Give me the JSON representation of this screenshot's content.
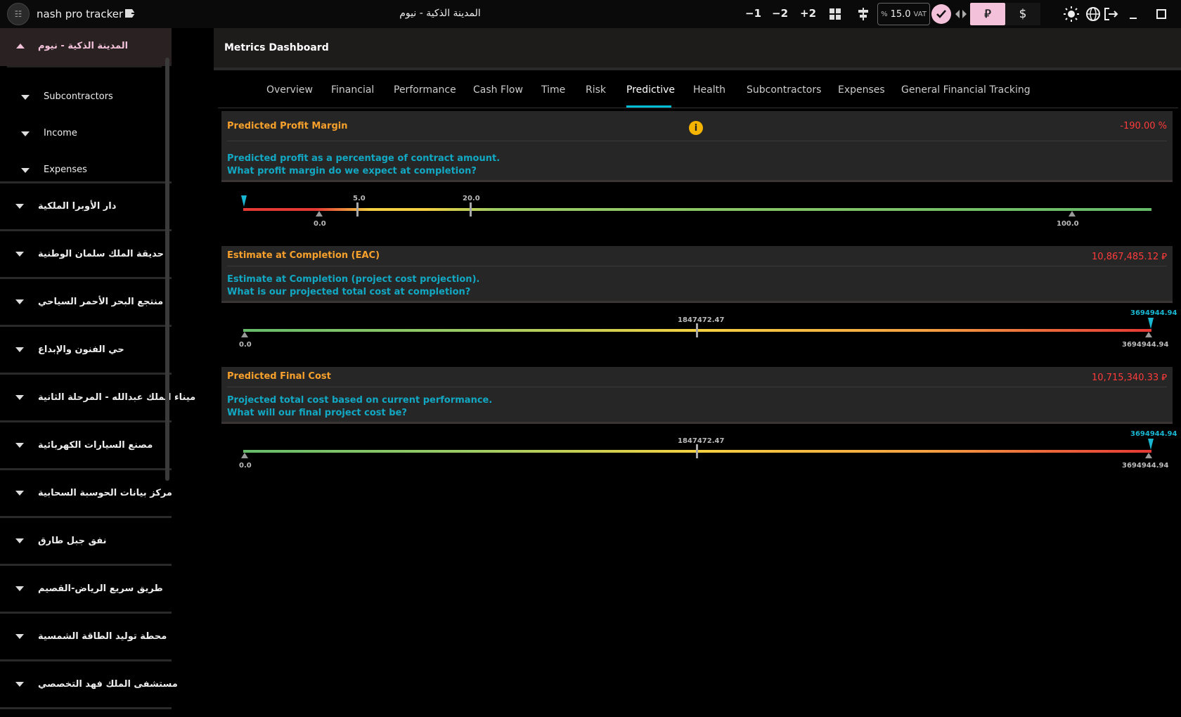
{
  "app": {
    "name": "nash pro tracker",
    "window_title": "المدينة الذكية - نيوم",
    "logo_icon": "app-logo-icon"
  },
  "toolbar": {
    "adjust_minus1": "−1",
    "adjust_minus2": "−2",
    "adjust_plus2": "+2",
    "vat_percent_sign": "%",
    "vat_value": "15.0",
    "vat_label": "VAT",
    "currency_sar": "⃁",
    "currency_usd": "$",
    "icons": [
      "export-icon",
      "grid-icon",
      "align-icon",
      "check-icon",
      "split-icon",
      "sun-icon",
      "globe-icon",
      "logout-icon",
      "minimize-icon",
      "maximize-icon"
    ]
  },
  "sidebar": {
    "expanded_project": "المدينة الذكية - نيوم",
    "sub_items": [
      "Subcontractors",
      "Income",
      "Expenses"
    ],
    "projects": [
      "دار الأوبرا الملكية",
      "حديقة الملك سلمان الوطنية",
      "منتجع البحر الأحمر السياحي",
      "حي الفنون والإبداع",
      "ميناء الملك عبدالله - المرحلة الثانية",
      "مصنع السيارات الكهربائية",
      "مركز بيانات الحوسبة السحابية",
      "نفق جبل طارق",
      "طريق سريع الرياض-القصيم",
      "محطة توليد الطاقة الشمسية",
      "مستشفى الملك فهد التخصصي"
    ]
  },
  "main": {
    "title": "Metrics Dashboard",
    "tabs": [
      "Overview",
      "Financial",
      "Performance",
      "Cash Flow",
      "Time",
      "Risk",
      "Predictive",
      "Health",
      "Subcontractors",
      "Expenses",
      "General Financial Tracking"
    ],
    "active_tab": "Predictive"
  },
  "metrics": [
    {
      "title": "Predicted Profit Margin",
      "value": "-190.00 %",
      "desc1": "Predicted profit as a percentage of contract amount.",
      "desc2": "What profit margin do we expect at completion?",
      "info_icon": "i",
      "gauge": {
        "labels": {
          "t0": "0.0",
          "t5": "5.0",
          "t20": "20.0",
          "t100": "100.0"
        },
        "marker_value": -190.0
      }
    },
    {
      "title": "Estimate at Completion (EAC)",
      "value": "10,867,485.12 ⃁",
      "desc1": "Estimate at Completion (project cost projection).",
      "desc2": "What is our projected total cost at completion?",
      "gauge": {
        "labels": {
          "min": "0.0",
          "mid": "1847472.47",
          "max": "3694944.94",
          "marker": "3694944.94"
        },
        "marker_value": 3694944.94
      }
    },
    {
      "title": "Predicted Final Cost",
      "value": "10,715,340.33 ⃁",
      "desc1": "Projected total cost based on current performance.",
      "desc2": "What will our final project cost be?",
      "gauge": {
        "labels": {
          "min": "0.0",
          "mid": "1847472.47",
          "max": "3694944.94",
          "marker": "3694944.94"
        },
        "marker_value": 3694944.94
      }
    }
  ],
  "colors": {
    "accent_pink": "#f3c1d9",
    "accent_cyan": "#19b6d1",
    "title_orange": "#f7a12c",
    "value_red": "#ff3b3b"
  }
}
